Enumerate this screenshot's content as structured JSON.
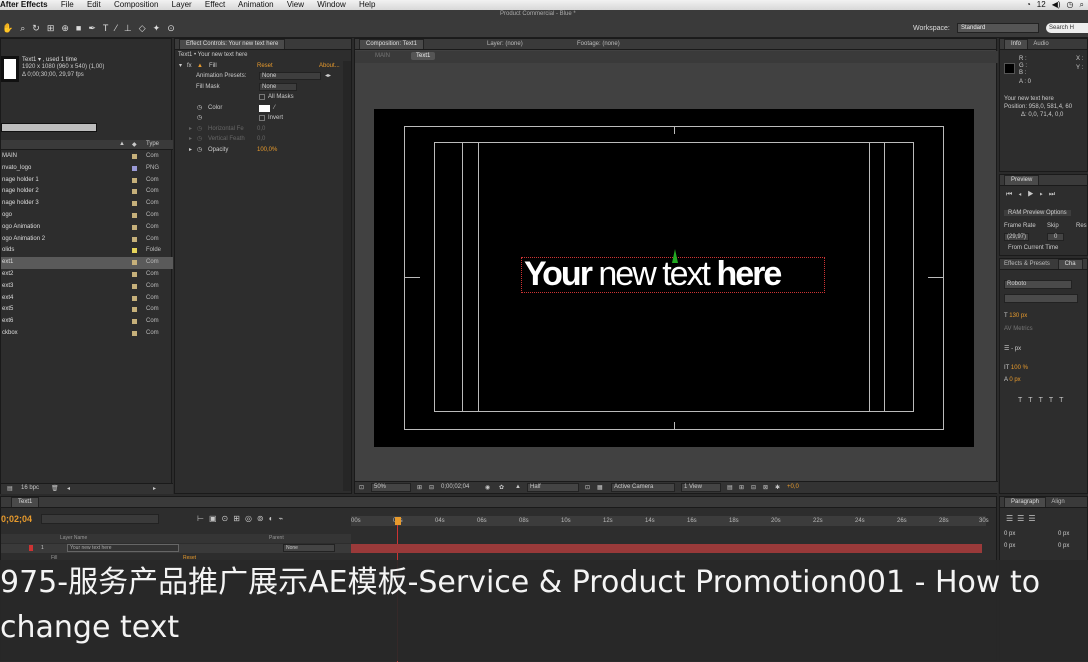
{
  "menubar": {
    "app": "After Effects",
    "items": [
      "File",
      "Edit",
      "Composition",
      "Layer",
      "Effect",
      "Animation",
      "View",
      "Window",
      "Help"
    ],
    "right_status": "12"
  },
  "document_title": "Product Commercial - Blue *",
  "workspace": {
    "label": "Workspace:",
    "value": "Standard",
    "search": "Search H"
  },
  "project": {
    "item_name": "Text1 ▾ , used 1 time",
    "item_size": "1920 x 1080  (960 x 540) (1,00)",
    "item_duration": "Δ 0;00;30;00, 29,97 fps",
    "type_header": "Type",
    "rows": [
      {
        "name": "MAIN",
        "type": "Com"
      },
      {
        "name": "nvato_logo",
        "type": "PNG"
      },
      {
        "name": "nage holder 1",
        "type": "Com"
      },
      {
        "name": "nage holder 2",
        "type": "Com"
      },
      {
        "name": "nage holder 3",
        "type": "Com"
      },
      {
        "name": "ogo",
        "type": "Com"
      },
      {
        "name": "ogo Animation",
        "type": "Com"
      },
      {
        "name": "ogo Animation 2",
        "type": "Com"
      },
      {
        "name": "olids",
        "type": "Folde"
      },
      {
        "name": "ext1",
        "type": "Com"
      },
      {
        "name": "ext2",
        "type": "Com"
      },
      {
        "name": "ext3",
        "type": "Com"
      },
      {
        "name": "ext4",
        "type": "Com"
      },
      {
        "name": "ext5",
        "type": "Com"
      },
      {
        "name": "ext6",
        "type": "Com"
      },
      {
        "name": "ckbox",
        "type": "Com"
      }
    ],
    "bpc": "16 bpc"
  },
  "effect_controls": {
    "tab": "Effect Controls: Your new text here",
    "path": "Text1 • Your new text here",
    "fill_label": "Fill",
    "reset": "Reset",
    "about": "About...",
    "animation_preset_label": "Animation Presets:",
    "animation_preset_value": "None",
    "fill_mask_label": "Fill Mask",
    "fill_mask_value": "None",
    "all_masks": "All Masks",
    "color_label": "Color",
    "invert": "Invert",
    "h_feather_label": "Horizontal Fe",
    "h_feather_value": "0,0",
    "v_feather_label": "Vertical Feath",
    "v_feather_value": "0,0",
    "opacity_label": "Opacity",
    "opacity_value": "100,0%"
  },
  "composition": {
    "tab": "Composition: Text1",
    "layer_tab": "Layer: (none)",
    "footage_tab": "Footage: (none)",
    "breadcrumb_main": "MAIN",
    "breadcrumb_text1": "Text1",
    "text_light": "Your ",
    "text_mid": "new text ",
    "text_bold": "here",
    "zoom": "50%",
    "timecode": "0;00;02;04",
    "resolution": "Half",
    "camera": "Active Camera",
    "views": "1 View",
    "exposure": "+0,0"
  },
  "info": {
    "tab_info": "Info",
    "tab_audio": "Audio",
    "r": "R :",
    "g": "G :",
    "b": "B :",
    "a": "A : 0",
    "x": "X :",
    "y": "Y :",
    "layer_name": "Your new text here",
    "position": "Position: 958,0, 581,4, 60",
    "delta": "Δ: 0,0, 71,4, 0,0"
  },
  "preview": {
    "tab": "Preview",
    "ram_options": "RAM Preview Options",
    "frame_rate_label": "Frame Rate",
    "skip_label": "Skip",
    "res_label": "Res",
    "frame_rate": "(29,97)",
    "skip": "0",
    "from_current": "From Current Time"
  },
  "character": {
    "tab_effects": "Effects & Presets",
    "tab_char": "Cha",
    "font": "Roboto",
    "size": "130 px",
    "tracking_label": "Metrics",
    "leading": "- px",
    "vscale": "100 %",
    "baseline": "0 px"
  },
  "timeline": {
    "tab": "Text1",
    "timecode": "0;02;04",
    "col_layer": "Layer Name",
    "col_parent": "Parent",
    "layer_num": "1",
    "layer_name": "Your new text here",
    "parent_value": "None",
    "sub_fill": "Fill",
    "sub_reset": "Reset",
    "ruler": [
      "00s",
      "02s",
      "04s",
      "06s",
      "08s",
      "10s",
      "12s",
      "14s",
      "16s",
      "18s",
      "20s",
      "22s",
      "24s",
      "26s",
      "28s",
      "30s"
    ]
  },
  "paragraph": {
    "tab": "Paragraph",
    "tab_align": "Align",
    "indent1": "0 px",
    "indent2": "0 px",
    "indent3": "0 px",
    "indent4": "0 px"
  },
  "caption": {
    "text": "975-服务产品推广展示AE模板-Service & Product Promotion001 - How to change text"
  }
}
